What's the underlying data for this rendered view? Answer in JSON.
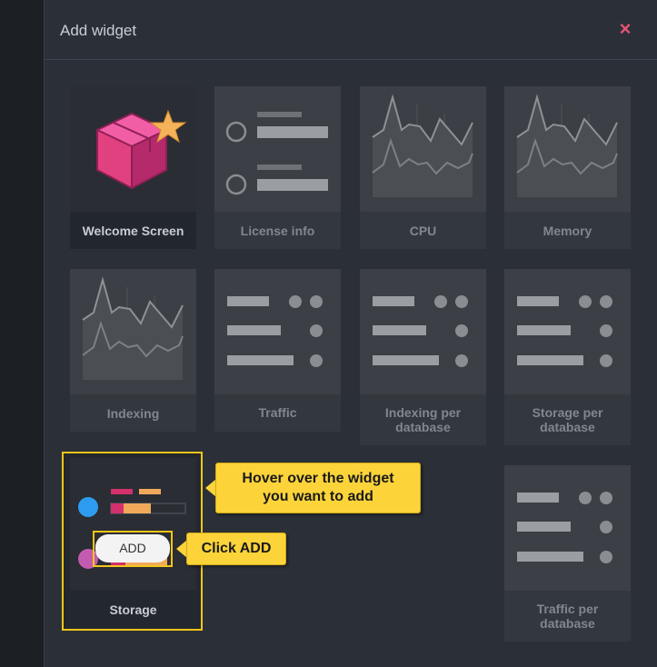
{
  "dialog": {
    "title": "Add widget",
    "close_icon": "×"
  },
  "widgets": [
    {
      "label": "Welcome Screen",
      "icon": "box-star-icon"
    },
    {
      "label": "License info",
      "icon": "license-list-icon"
    },
    {
      "label": "CPU",
      "icon": "line-graph-icon"
    },
    {
      "label": "Memory",
      "icon": "line-graph-icon"
    },
    {
      "label": "Indexing",
      "icon": "line-graph-icon"
    },
    {
      "label": "Traffic",
      "icon": "bar-list-icon"
    },
    {
      "label": "Indexing per database",
      "icon": "bar-list-icon"
    },
    {
      "label": "Storage per database",
      "icon": "bar-list-icon"
    },
    {
      "label": "Storage",
      "icon": "storage-bars-icon"
    },
    {
      "label": "Traffic per database",
      "icon": "bar-list-icon"
    }
  ],
  "add_button": {
    "label": "ADD"
  },
  "callouts": {
    "hover": "Hover over the widget you want to add",
    "click": "Click ADD"
  },
  "colors": {
    "highlight": "#f5c518",
    "close": "#e2546f",
    "callout_bg": "#fcd43a",
    "storage_red": "#d2316b",
    "storage_orange": "#f0a95a",
    "storage_blue": "#2d9cf0",
    "storage_purple": "#c35cb0"
  }
}
